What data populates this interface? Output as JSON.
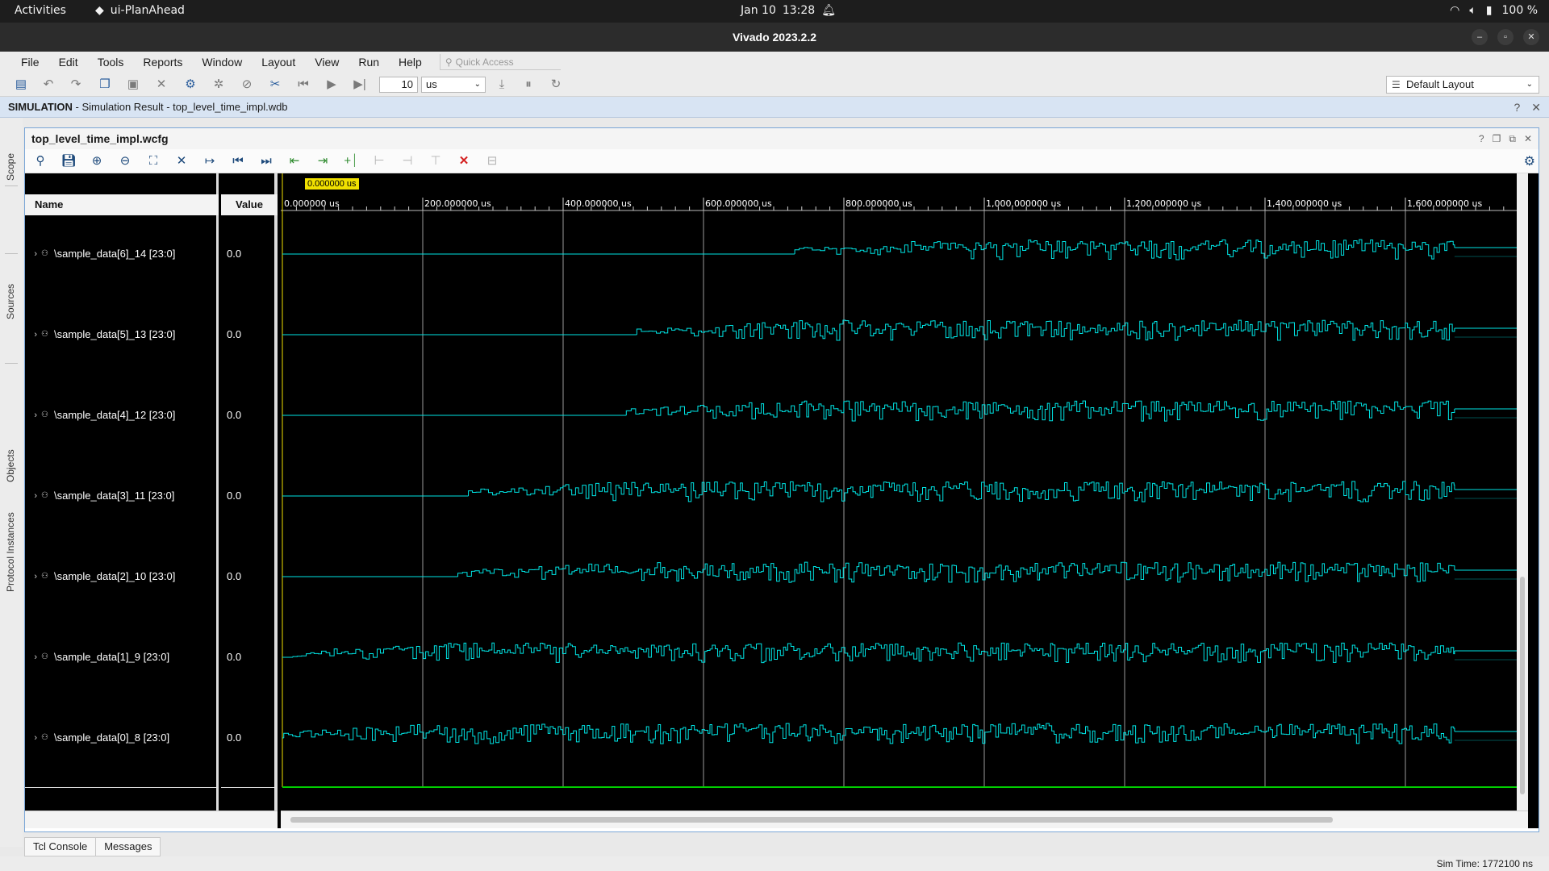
{
  "topbar": {
    "activities": "Activities",
    "app_name": "ui-PlanAhead",
    "date": "Jan 10",
    "time": "13:28",
    "battery": "100 %"
  },
  "window": {
    "title": "Vivado 2023.2.2"
  },
  "menu": {
    "items": [
      "File",
      "Edit",
      "Tools",
      "Reports",
      "Window",
      "Layout",
      "View",
      "Run",
      "Help"
    ],
    "quick_access_placeholder": "Quick Access"
  },
  "toolbar": {
    "run_time_value": "10",
    "run_time_unit": "us",
    "layout_selected": "Default Layout"
  },
  "sim_header": {
    "label": "SIMULATION",
    "subtitle": " - Simulation Result - top_level_time_impl.wdb"
  },
  "side_tabs": [
    "Scope",
    "Sources",
    "Objects",
    "Protocol Instances"
  ],
  "wave_window": {
    "title": "top_level_time_impl.wcfg",
    "name_header": "Name",
    "value_header": "Value",
    "cursor_time": "0.000000 us",
    "time_axis": {
      "unit": "us",
      "ticks": [
        "0.000000 us",
        "200.000000 us",
        "400.000000 us",
        "600.000000 us",
        "800.000000 us",
        "1,000.000000 us",
        "1,200.000000 us",
        "1,400.000000 us",
        "1,600.000000 us"
      ],
      "tick_values": [
        0,
        200,
        400,
        600,
        800,
        1000,
        1200,
        1400,
        1600
      ],
      "range_end": 1772.1
    },
    "signals": [
      {
        "name": "\\sample_data[6]_14 [23:0]",
        "value": "0.0",
        "activity_start": 730
      },
      {
        "name": "\\sample_data[5]_13 [23:0]",
        "value": "0.0",
        "activity_start": 505
      },
      {
        "name": "\\sample_data[4]_12 [23:0]",
        "value": "0.0",
        "activity_start": 490
      },
      {
        "name": "\\sample_data[3]_11 [23:0]",
        "value": "0.0",
        "activity_start": 265
      },
      {
        "name": "\\sample_data[2]_10 [23:0]",
        "value": "0.0",
        "activity_start": 250
      },
      {
        "name": "\\sample_data[1]_9 [23:0]",
        "value": "0.0",
        "activity_start": 15
      },
      {
        "name": "\\sample_data[0]_8 [23:0]",
        "value": "0.0",
        "activity_start": 2
      }
    ],
    "colors": {
      "trace": "#00e5e5",
      "grid": "#9a9a9a",
      "cursor": "#00d000",
      "background": "#000000"
    }
  },
  "bottom_tabs": [
    "Tcl Console",
    "Messages"
  ],
  "status": {
    "sim_time": "Sim Time: 1772100 ns"
  }
}
